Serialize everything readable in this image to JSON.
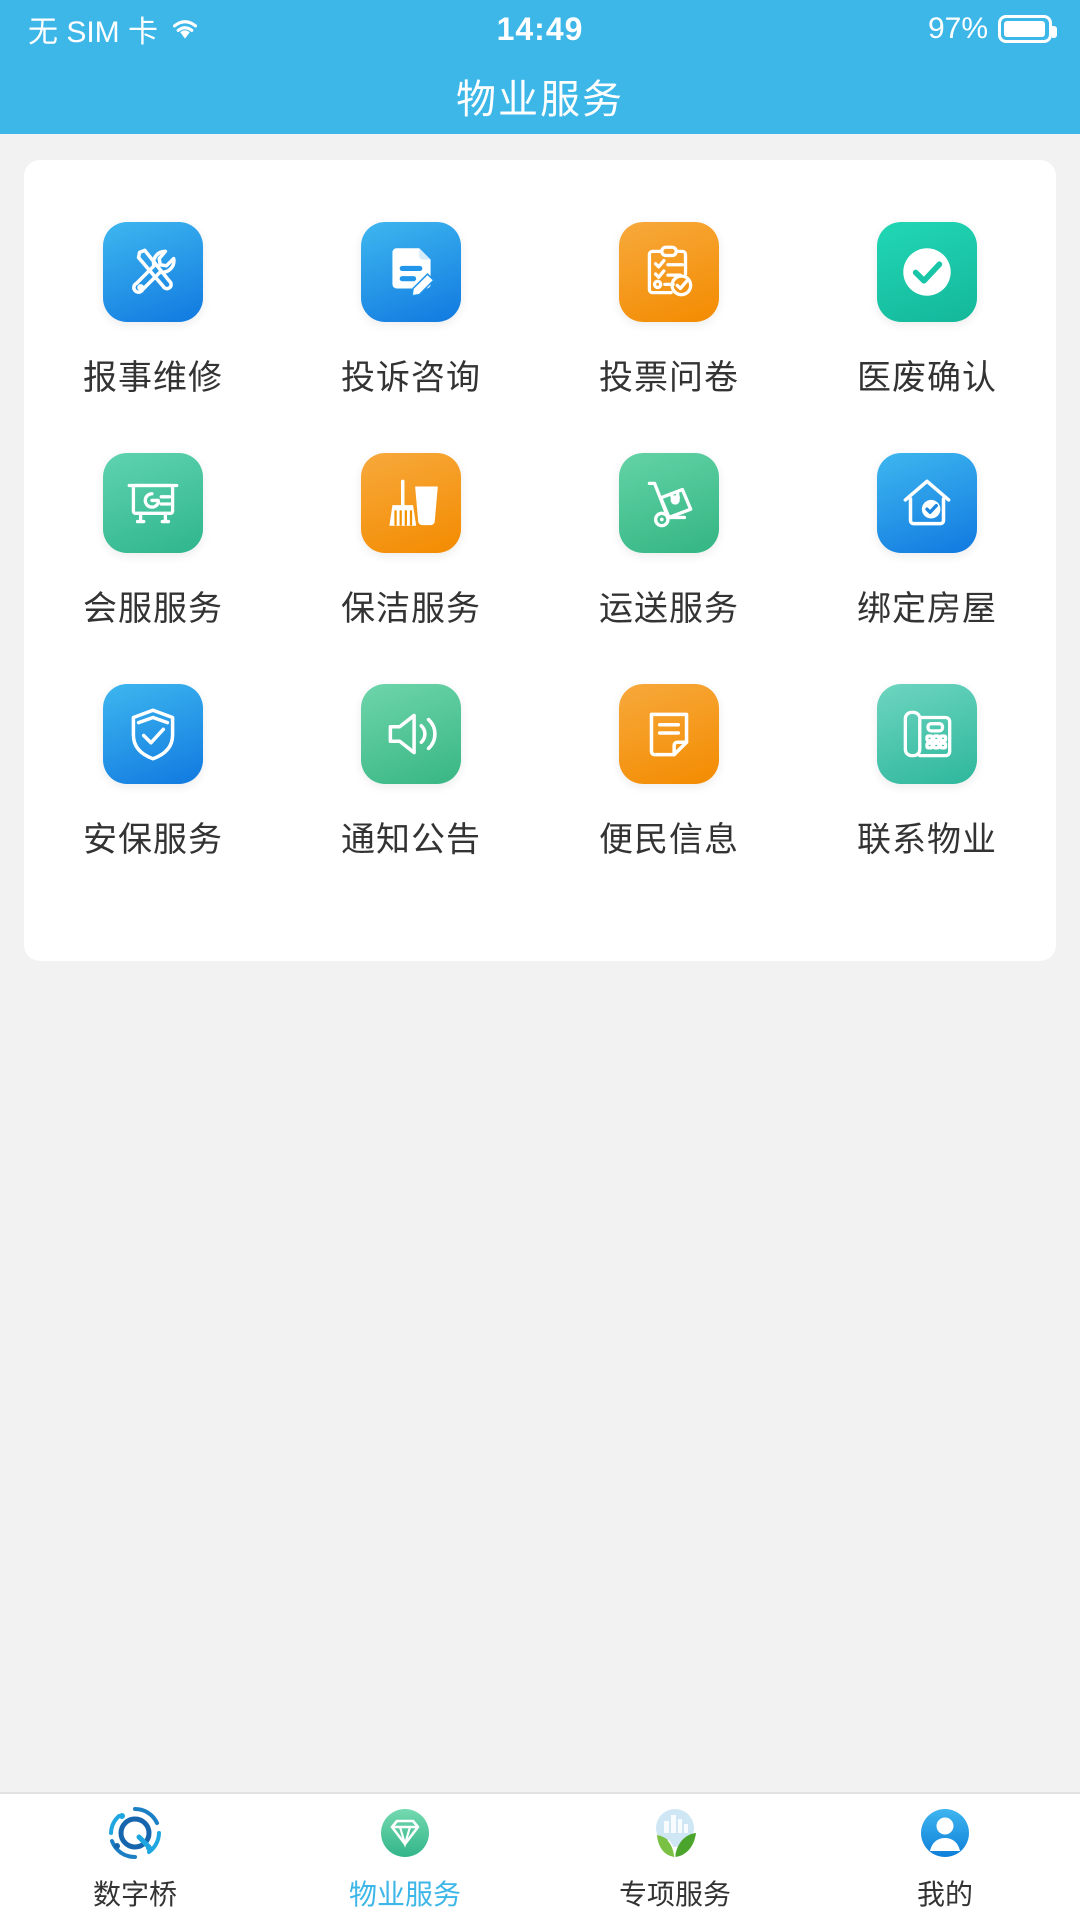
{
  "status_bar": {
    "carrier": "无 SIM 卡",
    "wifi_icon": "wifi-icon",
    "time": "14:49",
    "battery_percent": "97%",
    "battery_level": 97
  },
  "header": {
    "title": "物业服务",
    "background_color": "#3db6e8"
  },
  "services": {
    "items": [
      {
        "label": "报事维修",
        "icon": "tools-icon",
        "color_start": "#3eb7ef",
        "color_end": "#1179e0"
      },
      {
        "label": "投诉咨询",
        "icon": "document-edit-icon",
        "color_start": "#3eb7ef",
        "color_end": "#1179e0"
      },
      {
        "label": "投票问卷",
        "icon": "clipboard-check-icon",
        "color_start": "#f7a93c",
        "color_end": "#f38b00"
      },
      {
        "label": "医废确认",
        "icon": "check-circle-icon",
        "color_start": "#21d7b5",
        "color_end": "#14b79a"
      },
      {
        "label": "会服服务",
        "icon": "presentation-board-icon",
        "color_start": "#5fd3b0",
        "color_end": "#2fb58c"
      },
      {
        "label": "保洁服务",
        "icon": "broom-bucket-icon",
        "color_start": "#f7a93c",
        "color_end": "#f38b00"
      },
      {
        "label": "运送服务",
        "icon": "hand-truck-icon",
        "color_start": "#63d3a6",
        "color_end": "#34b583"
      },
      {
        "label": "绑定房屋",
        "icon": "house-check-icon",
        "color_start": "#3eb7ef",
        "color_end": "#1179e0"
      },
      {
        "label": "安保服务",
        "icon": "shield-check-icon",
        "color_start": "#3eb7ef",
        "color_end": "#1179e0"
      },
      {
        "label": "通知公告",
        "icon": "speaker-icon",
        "color_start": "#6ed5ab",
        "color_end": "#38b684"
      },
      {
        "label": "便民信息",
        "icon": "note-icon",
        "color_start": "#f7a93c",
        "color_end": "#f38b00"
      },
      {
        "label": "联系物业",
        "icon": "telephone-icon",
        "color_start": "#6ed5c0",
        "color_end": "#2db79c"
      }
    ]
  },
  "tabbar": {
    "active_color": "#3db6e8",
    "items": [
      {
        "label": "数字桥",
        "icon": "circuit-q-logo-icon",
        "active": false
      },
      {
        "label": "物业服务",
        "icon": "diamond-icon",
        "active": true
      },
      {
        "label": "专项服务",
        "icon": "city-leaf-icon",
        "active": false
      },
      {
        "label": "我的",
        "icon": "user-avatar-icon",
        "active": false
      }
    ]
  }
}
